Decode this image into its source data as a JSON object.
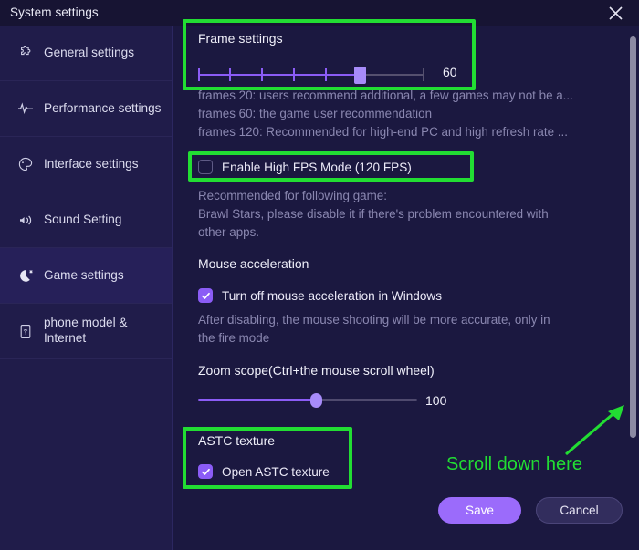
{
  "window": {
    "title": "System settings",
    "close_icon": "close-icon"
  },
  "sidebar": {
    "items": [
      {
        "label": "General settings",
        "icon": "puzzle-icon",
        "active": false
      },
      {
        "label": "Performance settings",
        "icon": "pulse-icon",
        "active": false
      },
      {
        "label": "Interface settings",
        "icon": "palette-icon",
        "active": false
      },
      {
        "label": "Sound Setting",
        "icon": "speaker-icon",
        "active": false
      },
      {
        "label": "Game settings",
        "icon": "game-icon",
        "active": true
      },
      {
        "label": "phone model & Internet",
        "icon": "phone-icon",
        "active": false
      }
    ]
  },
  "frame_settings": {
    "title": "Frame settings",
    "slider_value": "60",
    "hints": [
      "frames 20: users recommend additional, a few games may not be a...",
      "frames 60: the game user recommendation",
      "frames 120: Recommended for high-end PC and high refresh rate ..."
    ]
  },
  "high_fps": {
    "label": "Enable High FPS Mode (120 FPS)",
    "checked": false,
    "hints": [
      "Recommended for following game:",
      "Brawl Stars, please disable it if there's problem encountered with",
      "other apps."
    ]
  },
  "mouse_acceleration": {
    "title": "Mouse acceleration",
    "label": "Turn off mouse acceleration in Windows",
    "checked": true,
    "hints": [
      "After disabling, the mouse shooting will be more accurate, only in",
      "the fire mode"
    ]
  },
  "zoom_scope": {
    "title": "Zoom scope(Ctrl+the mouse scroll wheel)",
    "slider_value": "100"
  },
  "astc_texture": {
    "title": "ASTC texture",
    "label": "Open ASTC texture",
    "checked": true
  },
  "annotation": {
    "text": "Scroll down here",
    "arrow_icon": "arrow-up-right-icon",
    "color": "#22dd33"
  },
  "footer": {
    "save_label": "Save",
    "cancel_label": "Cancel"
  },
  "colors": {
    "accent": "#8b5cf6",
    "window_bg": "#1b1840",
    "sidebar_bg": "#201c4a",
    "titlebar_bg": "#171433",
    "highlight_green": "#22dd33"
  }
}
